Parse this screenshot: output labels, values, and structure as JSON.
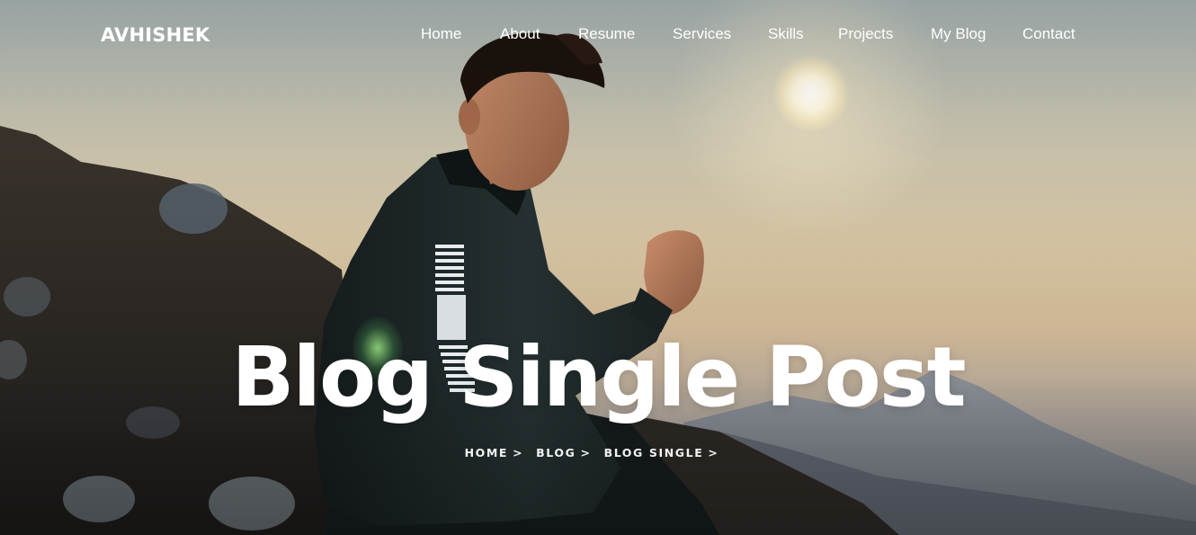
{
  "brand": "AVHISHEK",
  "nav": {
    "items": [
      {
        "label": "Home"
      },
      {
        "label": "About"
      },
      {
        "label": "Resume"
      },
      {
        "label": "Services"
      },
      {
        "label": "Skills"
      },
      {
        "label": "Projects"
      },
      {
        "label": "My Blog"
      },
      {
        "label": "Contact"
      }
    ]
  },
  "hero": {
    "title": "Blog Single Post",
    "breadcrumb": [
      {
        "label": "HOME"
      },
      {
        "label": "BLOG"
      },
      {
        "label": "BLOG SINGLE"
      }
    ],
    "separator": ">"
  },
  "colors": {
    "text": "#ffffff",
    "sky_top": "#a9b5b6",
    "sky_mid": "#d2c1a0",
    "rock": "#2a2622",
    "jacket": "#1e2526"
  }
}
